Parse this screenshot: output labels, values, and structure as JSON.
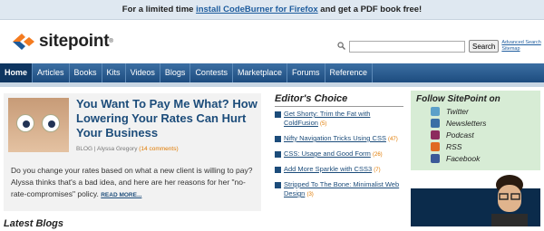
{
  "promo": {
    "pre": "For a limited time ",
    "link": "install CodeBurner for Firefox",
    "post": " and get a PDF book free!"
  },
  "brand": {
    "name": "sitepoint",
    "mark": "®"
  },
  "search": {
    "button": "Search",
    "links": [
      "Advanced Search",
      "Sitemap"
    ]
  },
  "nav": [
    "Home",
    "Articles",
    "Books",
    "Kits",
    "Videos",
    "Blogs",
    "Contests",
    "Marketplace",
    "Forums",
    "Reference"
  ],
  "feature": {
    "title": "You Want To Pay Me What? How Lowering Your Rates Can Hurt Your Business",
    "category": "BLOG",
    "author": "Alyssa Gregory",
    "comments": "(14 comments)",
    "body": "Do you change your rates based on what a new client is willing to pay? Alyssa thinks that's a bad idea, and here are her reasons for her \"no-rate-compromises\" policy.",
    "more": "READ MORE..."
  },
  "latest": "Latest Blogs",
  "editors": {
    "title": "Editor's Choice",
    "items": [
      {
        "title": "Get Shorty: Trim the Fat with ColdFusion",
        "count": "(5)"
      },
      {
        "title": "Nifty Navigation Tricks Using CSS",
        "count": "(47)"
      },
      {
        "title": "CSS: Usage and Good Form",
        "count": "(26)"
      },
      {
        "title": "Add More Sparkle with CSS3",
        "count": "(7)"
      },
      {
        "title": "Stripped To The Bone: Minimalist Web Design",
        "count": "(3)"
      }
    ]
  },
  "follow": {
    "title": "Follow SitePoint on",
    "items": [
      {
        "label": "Twitter",
        "icon": "twitter-icon",
        "color": "#5ba0c9"
      },
      {
        "label": "Newsletters",
        "icon": "newsletter-icon",
        "color": "#3b6fa5"
      },
      {
        "label": "Podcast",
        "icon": "podcast-icon",
        "color": "#8c2b5e"
      },
      {
        "label": "RSS",
        "icon": "rss-icon",
        "color": "#e06a22"
      },
      {
        "label": "Facebook",
        "icon": "facebook-icon",
        "color": "#3b5998"
      }
    ]
  }
}
